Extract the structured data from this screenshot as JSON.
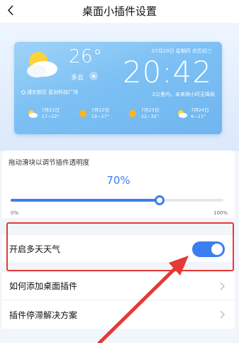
{
  "header": {
    "title": "桌面小插件设置"
  },
  "weather": {
    "temperature": "26°",
    "condition": "多云",
    "location": "浦东新区 星创科技广场",
    "date_line": "07月20日 星期四 农历初三",
    "time": "20:42",
    "rain_note": "3公里内，未来两小时无降雨",
    "forecast": [
      {
        "date": "7月21日",
        "range": "17~22°",
        "icon": "cloudy-icon"
      },
      {
        "date": "7月22日",
        "range": "19~27°",
        "icon": "sunny-icon"
      },
      {
        "date": "7月23日",
        "range": "22~32°",
        "icon": "sunny-icon"
      },
      {
        "date": "7月24日",
        "range": "6~11°",
        "icon": "cloudy-icon"
      }
    ]
  },
  "opacity": {
    "label": "拖动滑块以调节插件透明度",
    "value_text": "70%",
    "value": 70,
    "min_label": "0%",
    "max_label": "100%"
  },
  "settings": {
    "multi_day": {
      "label": "开启多天天气",
      "enabled": true
    },
    "add_widget": {
      "label": "如何添加桌面插件"
    },
    "freeze_fix": {
      "label": "插件停滞解决方案"
    }
  },
  "colors": {
    "accent": "#3b7ef0",
    "annotation": "#e53935"
  }
}
